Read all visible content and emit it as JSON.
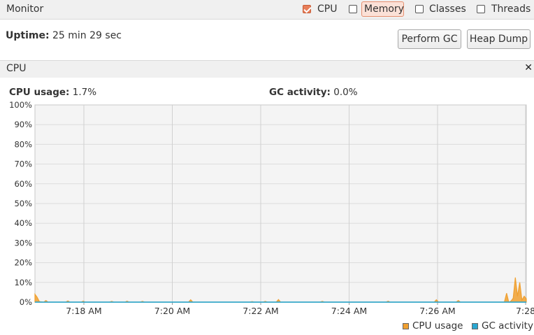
{
  "monitor": {
    "title": "Monitor",
    "checkboxes": [
      {
        "label": "CPU",
        "checked": true
      },
      {
        "label": "Memory",
        "checked": false
      },
      {
        "label": "Classes",
        "checked": false
      },
      {
        "label": "Threads",
        "checked": false
      }
    ]
  },
  "uptime": {
    "label": "Uptime:",
    "value": "25 min 29 sec"
  },
  "buttons": {
    "perform_gc": "Perform GC",
    "heap_dump": "Heap Dump"
  },
  "cpu_panel": {
    "title": "CPU",
    "close_icon": "close-icon",
    "cpu_usage_label": "CPU usage:",
    "cpu_usage_value": "1.7%",
    "gc_activity_label": "GC activity:",
    "gc_activity_value": "0.0%"
  },
  "chart_data": {
    "type": "area",
    "title": "",
    "x_ticks": [
      "7:18 AM",
      "7:20 AM",
      "7:22 AM",
      "7:24 AM",
      "7:26 AM",
      "7:28"
    ],
    "y_ticks": [
      "100%",
      "90%",
      "80%",
      "70%",
      "60%",
      "50%",
      "40%",
      "30%",
      "20%",
      "10%",
      "0%"
    ],
    "ylim": [
      0,
      100
    ],
    "xlim_minutes": [
      0,
      11.2
    ],
    "grid": true,
    "legend_position": "bottom-right",
    "series": [
      {
        "name": "CPU usage",
        "color": "#f0a030",
        "points": [
          [
            0,
            4
          ],
          [
            0.05,
            2.5
          ],
          [
            0.1,
            0.3
          ],
          [
            0.2,
            0
          ],
          [
            0.25,
            0.8
          ],
          [
            0.3,
            0
          ],
          [
            0.7,
            0
          ],
          [
            0.75,
            0.6
          ],
          [
            0.8,
            0
          ],
          [
            1.05,
            0
          ],
          [
            1.1,
            0.5
          ],
          [
            1.15,
            0
          ],
          [
            1.7,
            0
          ],
          [
            1.75,
            0.4
          ],
          [
            1.8,
            0
          ],
          [
            2.05,
            0
          ],
          [
            2.1,
            0.5
          ],
          [
            2.15,
            0
          ],
          [
            2.4,
            0
          ],
          [
            2.45,
            0.4
          ],
          [
            2.5,
            0
          ],
          [
            3.5,
            0
          ],
          [
            3.55,
            1.2
          ],
          [
            3.6,
            0
          ],
          [
            4.9,
            0
          ],
          [
            4.95,
            0.3
          ],
          [
            5,
            0
          ],
          [
            5.2,
            0
          ],
          [
            5.25,
            0.4
          ],
          [
            5.3,
            0
          ],
          [
            5.5,
            0
          ],
          [
            5.55,
            1.3
          ],
          [
            5.6,
            0
          ],
          [
            6.5,
            0
          ],
          [
            6.55,
            0.4
          ],
          [
            6.6,
            0
          ],
          [
            8,
            0
          ],
          [
            8.05,
            0.5
          ],
          [
            8.1,
            0
          ],
          [
            9.1,
            0
          ],
          [
            9.15,
            1.2
          ],
          [
            9.2,
            0
          ],
          [
            9.6,
            0
          ],
          [
            9.65,
            0.8
          ],
          [
            9.7,
            0
          ],
          [
            10.7,
            0
          ],
          [
            10.75,
            4.5
          ],
          [
            10.8,
            0
          ],
          [
            10.85,
            0.5
          ],
          [
            10.9,
            2
          ],
          [
            10.95,
            12.5
          ],
          [
            11.0,
            3
          ],
          [
            11.05,
            10
          ],
          [
            11.1,
            1
          ],
          [
            11.15,
            3
          ],
          [
            11.2,
            1.7
          ]
        ]
      },
      {
        "name": "GC activity",
        "color": "#2aa7d1",
        "points": [
          [
            0,
            0
          ],
          [
            11.2,
            0
          ]
        ]
      }
    ]
  }
}
